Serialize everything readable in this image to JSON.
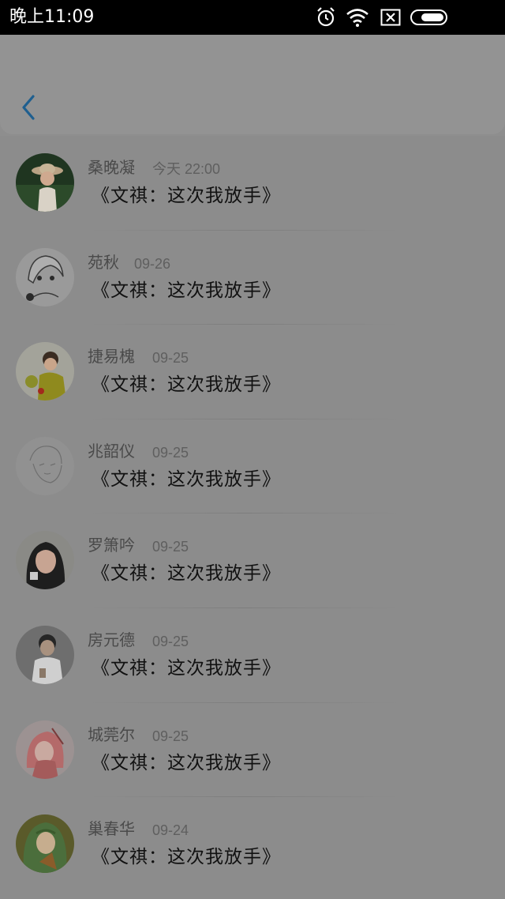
{
  "status_bar": {
    "time": "晚上11:09",
    "icons": [
      "alarm-icon",
      "wifi-icon",
      "sim-error-icon",
      "battery-icon"
    ]
  },
  "header": {
    "back_icon": "chevron-left-icon",
    "accent_color": "#1f5f8f"
  },
  "list": {
    "items": [
      {
        "name": "桑晚凝",
        "time": "今天 22:00",
        "title": "《文祺：这次我放手》",
        "avatar": "avatar-girl-hat"
      },
      {
        "name": "苑秋",
        "time": "09-26",
        "title": "《文祺：这次我放手》",
        "avatar": "avatar-sketch-girl"
      },
      {
        "name": "捷易槐",
        "time": "09-25",
        "title": "《文祺：这次我放手》",
        "avatar": "avatar-boy-yellow"
      },
      {
        "name": "兆韶仪",
        "time": "09-25",
        "title": "《文祺：这次我放手》",
        "avatar": "avatar-line-sketch"
      },
      {
        "name": "罗箫吟",
        "time": "09-25",
        "title": "《文祺：这次我放手》",
        "avatar": "avatar-girl-dark-hair"
      },
      {
        "name": "房元德",
        "time": "09-25",
        "title": "《文祺：这次我放手》",
        "avatar": "avatar-boy-grey"
      },
      {
        "name": "城莞尔",
        "time": "09-25",
        "title": "《文祺：这次我放手》",
        "avatar": "avatar-anime-red"
      },
      {
        "name": "巢春华",
        "time": "09-24",
        "title": "《文祺：这次我放手》",
        "avatar": "avatar-anime-green"
      }
    ]
  }
}
